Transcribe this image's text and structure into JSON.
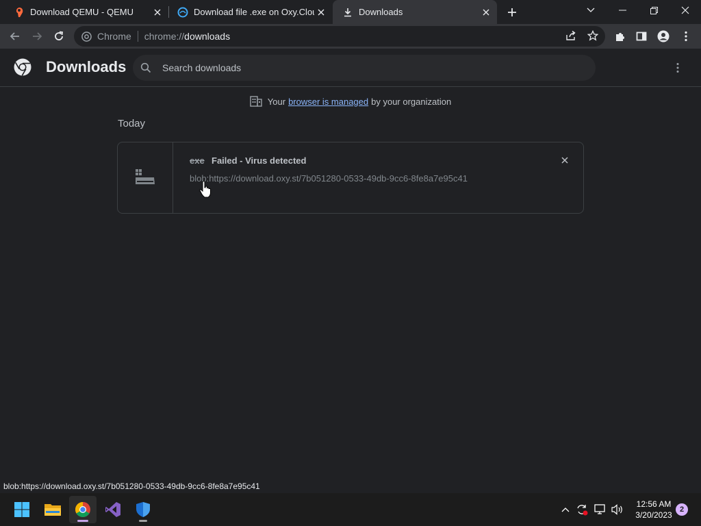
{
  "tabs": [
    {
      "title": "Download QEMU - QEMU",
      "active": false,
      "icon": "qemu-icon"
    },
    {
      "title": "Download file .exe on Oxy.Cloud",
      "active": false,
      "icon": "oxycloud-icon"
    },
    {
      "title": "Downloads",
      "active": true,
      "icon": "download-icon"
    }
  ],
  "omnibox": {
    "chip": "Chrome",
    "url_scheme": "chrome://",
    "url_host": "downloads"
  },
  "page": {
    "title": "Downloads",
    "search_placeholder": "Search downloads"
  },
  "managed": {
    "prefix": "Your",
    "link": "browser is managed",
    "suffix": "by your organization"
  },
  "list": {
    "day": "Today",
    "items": [
      {
        "filename": "exe",
        "status": "Failed - Virus detected",
        "source": "blob:https://download.oxy.st/7b051280-0533-49db-9cc6-8fe8a7e95c41"
      }
    ]
  },
  "status_bubble": "blob:https://download.oxy.st/7b051280-0533-49db-9cc6-8fe8a7e95c41",
  "taskbar": {
    "apps": [
      "start-icon",
      "file-explorer-icon",
      "chrome-icon",
      "visual-studio-icon",
      "defender-icon"
    ],
    "time": "12:56 AM",
    "date": "3/20/2023",
    "notifications": "2"
  },
  "colors": {
    "background": "#202124",
    "toolbar": "#35363a",
    "link": "#8ab4f8",
    "taskbar": "#1c1c1c"
  }
}
